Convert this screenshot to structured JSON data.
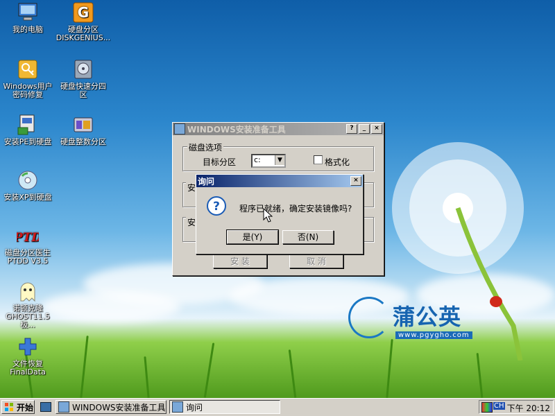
{
  "desktop": {
    "icons": [
      {
        "label": "我的电脑"
      },
      {
        "label": "硬盘分区\nDISKGENIUS..."
      },
      {
        "label": "Windows用户\n密码修复"
      },
      {
        "label": "硬盘快速分四\n区"
      },
      {
        "label": "安装PE到硬盘"
      },
      {
        "label": "硬盘整数分区"
      },
      {
        "label": "安装XP到硬盘"
      },
      {
        "label": "磁盘分区医生\nPTDD V3.5"
      },
      {
        "label": "诺顿克隆\nGHOST11.5极..."
      },
      {
        "label": "文件恢复\nFinalData"
      }
    ],
    "brand": {
      "name": "蒲公英",
      "url": "www.pgygho.com"
    }
  },
  "main_window": {
    "title": "WINDOWS安装准备工具",
    "group1_label": "磁盘选项",
    "target_label": "目标分区",
    "target_value": "c:",
    "format_label": "格式化",
    "group2_label": "安",
    "group3_label": "安",
    "install_label": "安 装",
    "cancel_label": "取 消"
  },
  "dialog": {
    "title": "询问",
    "message": "程序已就绪，确定安装镜像吗?",
    "yes_label": "是(Y)",
    "no_label": "否(N)"
  },
  "taskbar": {
    "start_label": "开始",
    "items": [
      {
        "label": "WINDOWS安装准备工具"
      },
      {
        "label": "询问"
      }
    ],
    "ime": "CH",
    "clock": "下午 20:12"
  },
  "colors": {
    "title_active": "#0a246a",
    "title_inactive": "#808080",
    "face": "#d4d0c8"
  }
}
